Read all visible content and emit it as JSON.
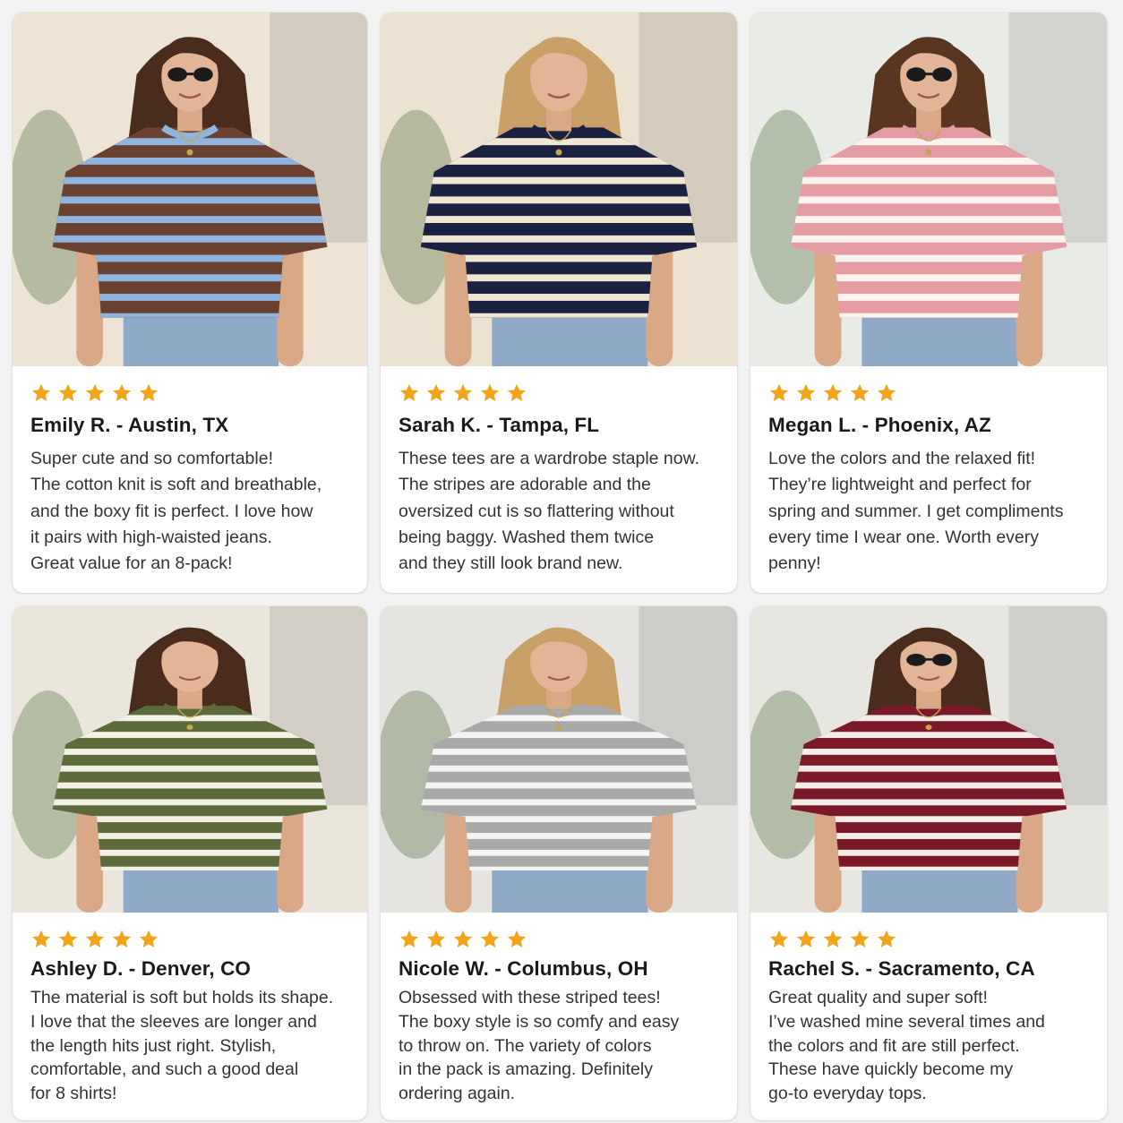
{
  "colors": {
    "star": "#F2A51A",
    "name": "#1a1a1a",
    "text": "#333333",
    "card": "#ffffff",
    "page": "#f3f3f3"
  },
  "reviews": [
    {
      "rating": 5,
      "name": "Emily R. - Austin, TX",
      "lines": [
        "Super cute and so comfortable!",
        "The cotton knit is soft and breathable,",
        "and the boxy fit is perfect. I love how",
        "it pairs with high-waisted jeans.",
        "Great value for an 8-pack!"
      ],
      "photo": {
        "shirt": "#6b4232",
        "stripe": "#8fb4de",
        "collar": "#8fb4de",
        "hair": "#4a2c1c",
        "bg": "#ede4d6",
        "sunglasses": true
      }
    },
    {
      "rating": 5,
      "name": "Sarah K. - Tampa, FL",
      "lines": [
        "These tees are a wardrobe staple now.",
        "The stripes are adorable and the",
        "oversized cut is so flattering without",
        "being baggy. Washed them twice",
        "and they still look brand new."
      ],
      "photo": {
        "shirt": "#1c2142",
        "stripe": "#efe6d3",
        "collar": "#1c2142",
        "hair": "#c9a067",
        "bg": "#ece2d2",
        "sunglasses": false
      }
    },
    {
      "rating": 5,
      "name": "Megan L. - Phoenix, AZ",
      "lines": [
        "Love the colors and the relaxed fit!",
        "They’re lightweight and perfect for",
        "spring and summer. I get compliments",
        "every time I wear one. Worth every",
        "penny!"
      ],
      "photo": {
        "shirt": "#e39ca1",
        "stripe": "#fbf3ef",
        "collar": "#e39ca1",
        "hair": "#5a3520",
        "bg": "#e9ece6",
        "sunglasses": true
      }
    },
    {
      "rating": 5,
      "name": "Ashley D. - Denver, CO",
      "lines": [
        "The material is soft but holds its shape.",
        "I love that the sleeves are longer and",
        "the length hits just right. Stylish,",
        "comfortable, and such a good deal",
        "for 8 shirts!"
      ],
      "photo": {
        "shirt": "#5d6b3a",
        "stripe": "#f3f0e6",
        "collar": "#5d6b3a",
        "hair": "#4a2c1c",
        "bg": "#ebe6dc",
        "sunglasses": false
      }
    },
    {
      "rating": 5,
      "name": "Nicole W. - Columbus, OH",
      "lines": [
        "Obsessed with these striped tees!",
        "The boxy style is so comfy and easy",
        "to throw on. The variety of colors",
        "in the pack is amazing. Definitely",
        "ordering again."
      ],
      "photo": {
        "shirt": "#a9a9a9",
        "stripe": "#f4f4f2",
        "collar": "#a9a9a9",
        "hair": "#c9a067",
        "bg": "#e6e4e0",
        "sunglasses": false
      }
    },
    {
      "rating": 5,
      "name": "Rachel S. - Sacramento, CA",
      "lines": [
        "Great quality and super soft!",
        "I’ve washed mine several times and",
        "the colors and fit are still perfect.",
        "These have quickly become my",
        "go-to everyday tops."
      ],
      "photo": {
        "shirt": "#7a1a28",
        "stripe": "#f2ede8",
        "collar": "#7a1a28",
        "hair": "#4a2c1c",
        "bg": "#e8e6e1",
        "sunglasses": true
      }
    }
  ]
}
